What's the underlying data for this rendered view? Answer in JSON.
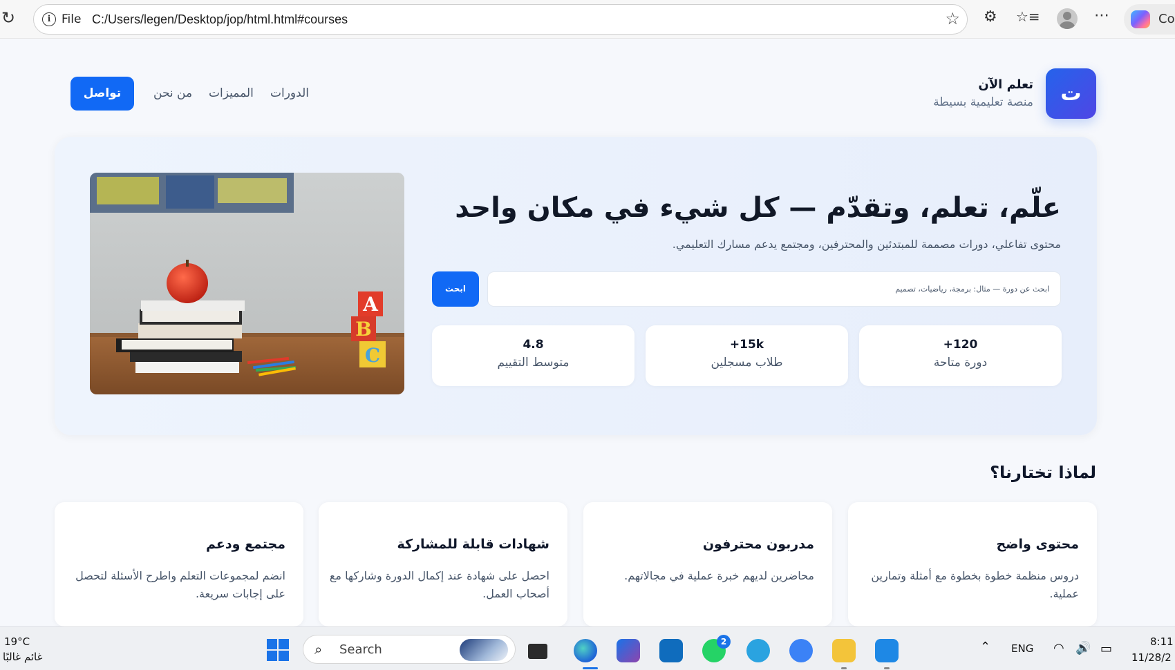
{
  "browser": {
    "file_label": "File",
    "url": "C:/Users/legen/Desktop/jop/html.html#courses",
    "copilot_label": "Co"
  },
  "header": {
    "logo_letter": "ت",
    "brand_title": "تعلم الآن",
    "brand_subtitle": "منصة تعليمية بسيطة",
    "nav": [
      "الدورات",
      "المميزات",
      "من نحن"
    ],
    "contact_label": "تواصل"
  },
  "hero": {
    "title": "علّم، تعلم، وتقدّم — كل شيء في مكان واحد",
    "subtitle": "محتوى تفاعلي، دورات مصممة للمبتدئين والمحترفين، ومجتمع يدعم مسارك التعليمي.",
    "search_placeholder": "ابحث عن دورة — مثال: برمجة، رياضيات، تصميم",
    "search_button": "ابحث",
    "stats": [
      {
        "value": "+120",
        "label": "دورة متاحة"
      },
      {
        "value": "+15k",
        "label": "طلاب مسجلين"
      },
      {
        "value": "4.8",
        "label": "متوسط التقييم"
      }
    ]
  },
  "why": {
    "title": "لماذا تختارنا؟",
    "features": [
      {
        "title": "محتوى واضح",
        "desc": "دروس منظمة خطوة بخطوة مع أمثلة وتمارين عملية."
      },
      {
        "title": "مدربون محترفون",
        "desc": "محاضرين لديهم خبرة عملية في مجالاتهم."
      },
      {
        "title": "شهادات قابلة للمشاركة",
        "desc": "احصل على شهادة عند إكمال الدورة وشاركها مع أصحاب العمل."
      },
      {
        "title": "مجتمع ودعم",
        "desc": "انضم لمجموعات التعلم واطرح الأسئلة لتحصل على إجابات سريعة."
      }
    ]
  },
  "taskbar": {
    "temperature": "19°C",
    "weather": "غائم غالبًا",
    "search_label": "Search",
    "whatsapp_badge": "2",
    "language": "ENG",
    "time": "8:11",
    "date": "11/28/2"
  },
  "colors": {
    "primary": "#1169f5",
    "logo_gradient_start": "#2563eb",
    "logo_gradient_end": "#4f46e5",
    "hero_bg": "#eef4fd",
    "page_bg": "#f6f8fc"
  }
}
